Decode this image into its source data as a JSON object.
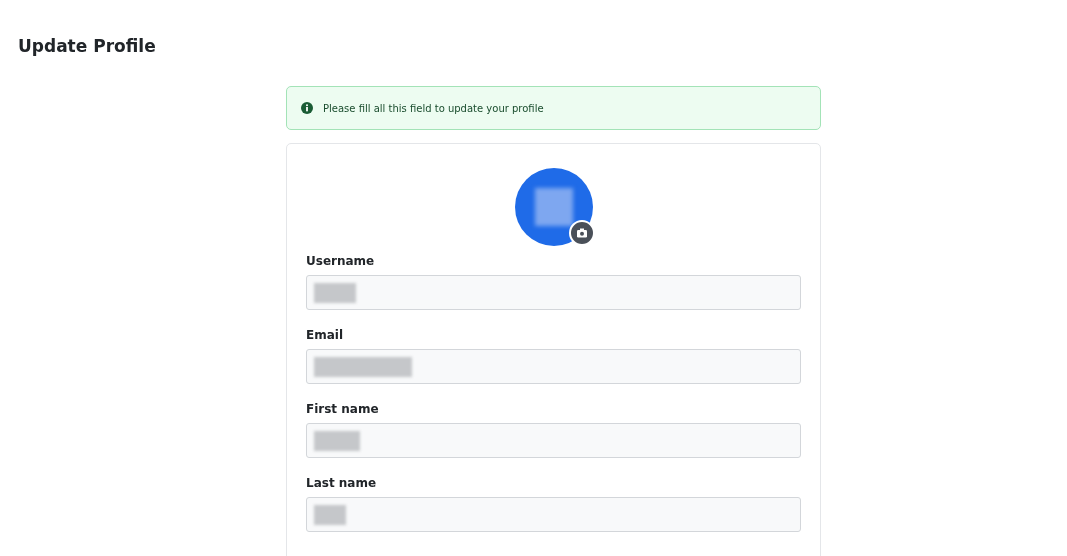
{
  "page": {
    "title": "Update Profile"
  },
  "alert": {
    "message": "Please fill all this field to update your profile"
  },
  "avatar": {
    "redacted": true
  },
  "fields": [
    {
      "label": "Username",
      "redacted": true
    },
    {
      "label": "Email",
      "redacted": true
    },
    {
      "label": "First name",
      "redacted": true
    },
    {
      "label": "Last name",
      "redacted": true
    }
  ]
}
